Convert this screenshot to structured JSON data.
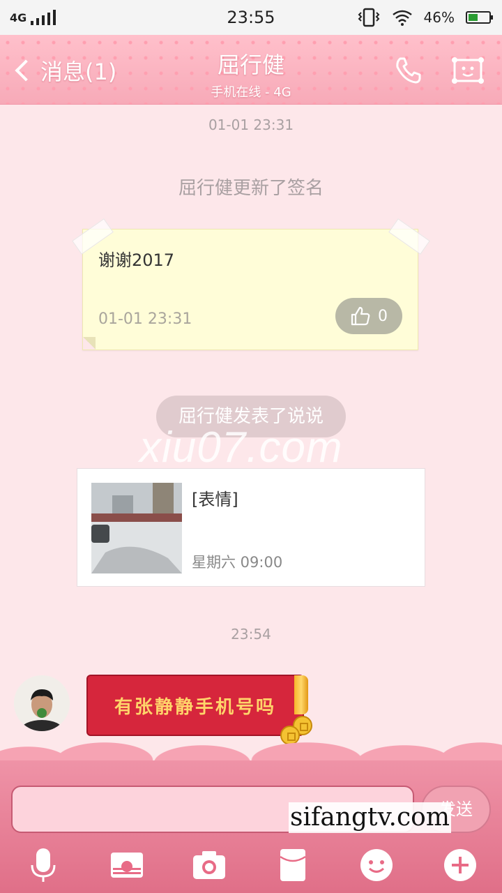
{
  "status_bar": {
    "network": "4G",
    "time": "23:55",
    "battery": "46%",
    "battery_level": 0.46
  },
  "header": {
    "back_label": "消息(1)",
    "contact_name": "屈行健",
    "contact_status": "手机在线 - 4G",
    "icons": [
      "phone-icon",
      "profile-icon"
    ]
  },
  "chat": {
    "stamp1": "01-01 23:31",
    "signature_notice": "屈行健更新了签名",
    "signature": {
      "text": "谢谢2017",
      "date": "01-01 23:31",
      "likes": "0"
    },
    "post_notice": "屈行健发表了说说",
    "watermark_top": "xiu07.com",
    "post": {
      "title": "[表情]",
      "time": "星期六 09:00"
    },
    "stamp2": "23:54",
    "red_packet_text": "有张静静手机号吗"
  },
  "composer": {
    "send_label": "发送",
    "watermark_bottom": "sifangtv.com"
  },
  "toolbar": {
    "icons": [
      "microphone-icon",
      "gallery-icon",
      "camera-icon",
      "red-packet-icon",
      "emoji-icon",
      "plus-icon"
    ]
  },
  "colors": {
    "header_pink": "#ffc0cb",
    "background": "#fde7ea",
    "red_packet": "#d6263c",
    "note_yellow": "#fffdd8"
  }
}
